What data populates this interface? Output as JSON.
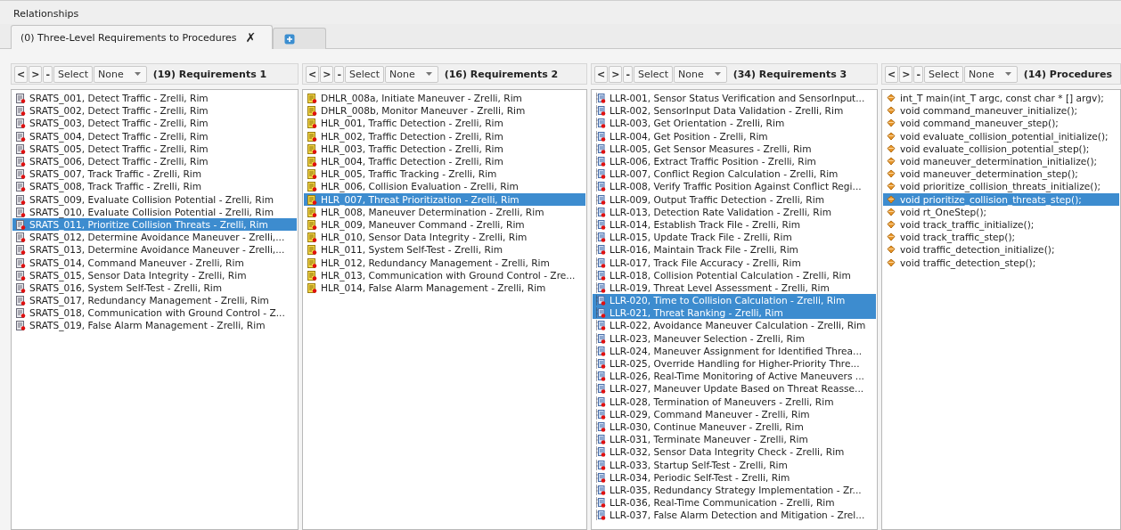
{
  "panel": {
    "title": "Relationships"
  },
  "tabs": [
    {
      "label": "(0) Three-Level Requirements to Procedures",
      "close": "✗",
      "selected": true
    }
  ],
  "lists": [
    {
      "kind": "srats",
      "nav": [
        "<",
        ">",
        "-"
      ],
      "select": "Select",
      "filter": "None",
      "heading": "(19) Requirements 1",
      "items": [
        {
          "text": "SRATS_001, Detect Traffic - Zrelli, Rim",
          "selected": false
        },
        {
          "text": "SRATS_002, Detect Traffic - Zrelli, Rim",
          "selected": false
        },
        {
          "text": "SRATS_003, Detect Traffic - Zrelli, Rim",
          "selected": false
        },
        {
          "text": "SRATS_004, Detect Traffic - Zrelli, Rim",
          "selected": false
        },
        {
          "text": "SRATS_005, Detect Traffic - Zrelli, Rim",
          "selected": false
        },
        {
          "text": "SRATS_006, Detect Traffic - Zrelli, Rim",
          "selected": false
        },
        {
          "text": "SRATS_007, Track Traffic - Zrelli, Rim",
          "selected": false
        },
        {
          "text": "SRATS_008, Track Traffic - Zrelli, Rim",
          "selected": false
        },
        {
          "text": "SRATS_009, Evaluate Collision Potential - Zrelli, Rim",
          "selected": false
        },
        {
          "text": "SRATS_010, Evaluate Collision Potential - Zrelli, Rim",
          "selected": false
        },
        {
          "text": "SRATS_011, Prioritize Collision Threats - Zrelli, Rim",
          "selected": true
        },
        {
          "text": "SRATS_012, Determine Avoidance Maneuver - Zrelli,...",
          "selected": false
        },
        {
          "text": "SRATS_013, Determine Avoidance Maneuver - Zrelli,...",
          "selected": false
        },
        {
          "text": "SRATS_014, Command Maneuver - Zrelli, Rim",
          "selected": false
        },
        {
          "text": "SRATS_015, Sensor Data Integrity - Zrelli, Rim",
          "selected": false
        },
        {
          "text": "SRATS_016, System Self-Test - Zrelli, Rim",
          "selected": false
        },
        {
          "text": "SRATS_017, Redundancy Management - Zrelli, Rim",
          "selected": false
        },
        {
          "text": "SRATS_018, Communication with Ground Control - Z...",
          "selected": false
        },
        {
          "text": "SRATS_019, False Alarm Management - Zrelli, Rim",
          "selected": false
        }
      ]
    },
    {
      "kind": "hlr",
      "nav": [
        "<",
        ">",
        "-"
      ],
      "select": "Select",
      "filter": "None",
      "heading": "(16) Requirements 2",
      "items": [
        {
          "text": "DHLR_008a, Initiate Maneuver - Zrelli, Rim",
          "selected": false
        },
        {
          "text": "DHLR_008b, Monitor Maneuver - Zrelli, Rim",
          "selected": false
        },
        {
          "text": "HLR_001, Traffic Detection - Zrelli, Rim",
          "selected": false
        },
        {
          "text": "HLR_002, Traffic Detection - Zrelli, Rim",
          "selected": false
        },
        {
          "text": "HLR_003, Traffic Detection - Zrelli, Rim",
          "selected": false
        },
        {
          "text": "HLR_004, Traffic Detection - Zrelli, Rim",
          "selected": false
        },
        {
          "text": "HLR_005, Traffic Tracking - Zrelli, Rim",
          "selected": false
        },
        {
          "text": "HLR_006, Collision Evaluation - Zrelli, Rim",
          "selected": false
        },
        {
          "text": "HLR_007, Threat Prioritization - Zrelli, Rim",
          "selected": true
        },
        {
          "text": "HLR_008, Maneuver Determination - Zrelli, Rim",
          "selected": false
        },
        {
          "text": "HLR_009, Maneuver Command - Zrelli, Rim",
          "selected": false
        },
        {
          "text": "HLR_010, Sensor Data Integrity - Zrelli, Rim",
          "selected": false
        },
        {
          "text": "HLR_011, System Self-Test - Zrelli, Rim",
          "selected": false
        },
        {
          "text": "HLR_012, Redundancy Management - Zrelli, Rim",
          "selected": false
        },
        {
          "text": "HLR_013, Communication with Ground Control - Zre...",
          "selected": false
        },
        {
          "text": "HLR_014, False Alarm Management - Zrelli, Rim",
          "selected": false
        }
      ]
    },
    {
      "kind": "llr",
      "nav": [
        "<",
        ">",
        "-"
      ],
      "select": "Select",
      "filter": "None",
      "heading": "(34) Requirements 3",
      "items": [
        {
          "text": "LLR-001, Sensor Status Verification and SensorInput...",
          "selected": false
        },
        {
          "text": "LLR-002, SensorInput Data Validation - Zrelli, Rim",
          "selected": false
        },
        {
          "text": "LLR-003, Get Orientation - Zrelli, Rim",
          "selected": false
        },
        {
          "text": "LLR-004, Get Position - Zrelli, Rim",
          "selected": false
        },
        {
          "text": "LLR-005, Get Sensor Measures - Zrelli, Rim",
          "selected": false
        },
        {
          "text": "LLR-006, Extract Traffic Position - Zrelli, Rim",
          "selected": false
        },
        {
          "text": "LLR-007, Conflict Region Calculation - Zrelli, Rim",
          "selected": false
        },
        {
          "text": "LLR-008, Verify Traffic Position Against Conflict Regi...",
          "selected": false
        },
        {
          "text": "LLR-009, Output Traffic Detection - Zrelli, Rim",
          "selected": false
        },
        {
          "text": "LLR-013, Detection Rate Validation - Zrelli, Rim",
          "selected": false
        },
        {
          "text": "LLR-014, Establish Track File - Zrelli, Rim",
          "selected": false
        },
        {
          "text": "LLR-015, Update Track File - Zrelli, Rim",
          "selected": false
        },
        {
          "text": "LLR-016, Maintain Track File - Zrelli, Rim",
          "selected": false
        },
        {
          "text": "LLR-017, Track File Accuracy - Zrelli, Rim",
          "selected": false
        },
        {
          "text": "LLR-018, Collision Potential Calculation - Zrelli, Rim",
          "selected": false
        },
        {
          "text": "LLR-019, Threat Level Assessment - Zrelli, Rim",
          "selected": false
        },
        {
          "text": "LLR-020, Time to Collision Calculation - Zrelli, Rim",
          "selected": true
        },
        {
          "text": "LLR-021, Threat Ranking - Zrelli, Rim",
          "selected": true
        },
        {
          "text": "LLR-022, Avoidance Maneuver Calculation - Zrelli, Rim",
          "selected": false
        },
        {
          "text": "LLR-023, Maneuver Selection - Zrelli, Rim",
          "selected": false
        },
        {
          "text": "LLR-024, Maneuver Assignment for Identified Threa...",
          "selected": false
        },
        {
          "text": "LLR-025, Override Handling for Higher-Priority Thre...",
          "selected": false
        },
        {
          "text": "LLR-026, Real-Time Monitoring of Active Maneuvers ...",
          "selected": false
        },
        {
          "text": "LLR-027, Maneuver Update Based on Threat Reasse...",
          "selected": false
        },
        {
          "text": "LLR-028, Termination of Maneuvers - Zrelli, Rim",
          "selected": false
        },
        {
          "text": "LLR-029, Command Maneuver - Zrelli, Rim",
          "selected": false
        },
        {
          "text": "LLR-030, Continue Maneuver - Zrelli, Rim",
          "selected": false
        },
        {
          "text": "LLR-031, Terminate Maneuver - Zrelli, Rim",
          "selected": false
        },
        {
          "text": "LLR-032, Sensor Data Integrity Check - Zrelli, Rim",
          "selected": false
        },
        {
          "text": "LLR-033, Startup Self-Test - Zrelli, Rim",
          "selected": false
        },
        {
          "text": "LLR-034, Periodic Self-Test - Zrelli, Rim",
          "selected": false
        },
        {
          "text": "LLR-035, Redundancy Strategy Implementation - Zr...",
          "selected": false
        },
        {
          "text": "LLR-036, Real-Time Communication - Zrelli, Rim",
          "selected": false
        },
        {
          "text": "LLR-037, False Alarm Detection and Mitigation - Zrel...",
          "selected": false
        }
      ]
    },
    {
      "kind": "procedure",
      "nav": [
        "<",
        ">",
        "-"
      ],
      "select": "Select",
      "filter": "None",
      "heading": "(14) Procedures",
      "items": [
        {
          "text": "int_T main(int_T argc, const char * [] argv);",
          "selected": false
        },
        {
          "text": "void command_maneuver_initialize();",
          "selected": false
        },
        {
          "text": "void command_maneuver_step();",
          "selected": false
        },
        {
          "text": "void evaluate_collision_potential_initialize();",
          "selected": false
        },
        {
          "text": "void evaluate_collision_potential_step();",
          "selected": false
        },
        {
          "text": "void maneuver_determination_initialize();",
          "selected": false
        },
        {
          "text": "void maneuver_determination_step();",
          "selected": false
        },
        {
          "text": "void prioritize_collision_threats_initialize();",
          "selected": false
        },
        {
          "text": "void prioritize_collision_threats_step();",
          "selected": true
        },
        {
          "text": "void rt_OneStep();",
          "selected": false
        },
        {
          "text": "void track_traffic_initialize();",
          "selected": false
        },
        {
          "text": "void track_traffic_step();",
          "selected": false
        },
        {
          "text": "void traffic_detection_initialize();",
          "selected": false
        },
        {
          "text": "void traffic_detection_step();",
          "selected": false
        }
      ]
    }
  ]
}
